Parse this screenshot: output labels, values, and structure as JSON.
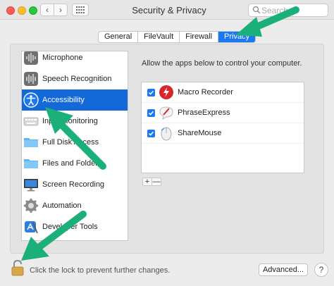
{
  "window": {
    "title": "Security & Privacy"
  },
  "search": {
    "placeholder": "Search"
  },
  "tabs": [
    {
      "label": "General"
    },
    {
      "label": "FileVault"
    },
    {
      "label": "Firewall"
    },
    {
      "label": "Privacy"
    }
  ],
  "sidebar": {
    "items": [
      {
        "label": "Microphone",
        "icon": "microphone-icon"
      },
      {
        "label": "Speech Recognition",
        "icon": "speech-recognition-icon"
      },
      {
        "label": "Accessibility",
        "icon": "accessibility-icon",
        "selected": true
      },
      {
        "label": "Input Monitoring",
        "icon": "keyboard-icon"
      },
      {
        "label": "Full Disk Access",
        "icon": "folder-icon"
      },
      {
        "label": "Files and Folders",
        "icon": "folder-icon"
      },
      {
        "label": "Screen Recording",
        "icon": "display-icon"
      },
      {
        "label": "Automation",
        "icon": "gear-icon"
      },
      {
        "label": "Developer Tools",
        "icon": "developer-tools-icon"
      }
    ]
  },
  "main": {
    "allow_text": "Allow the apps below to control your computer.",
    "apps": [
      {
        "name": "Macro Recorder",
        "checked": true,
        "icon": "macro-recorder-icon"
      },
      {
        "name": "PhraseExpress",
        "checked": true,
        "icon": "phraseexpress-icon"
      },
      {
        "name": "ShareMouse",
        "checked": true,
        "icon": "sharemouse-icon"
      }
    ],
    "add_label": "+",
    "remove_label": "—"
  },
  "footer": {
    "lock_text": "Click the lock to prevent further changes.",
    "advanced_label": "Advanced...",
    "help_label": "?"
  },
  "colors": {
    "accent": "#1a78f2",
    "selection": "#1469d8",
    "annotation_arrow": "#1bb07a"
  }
}
